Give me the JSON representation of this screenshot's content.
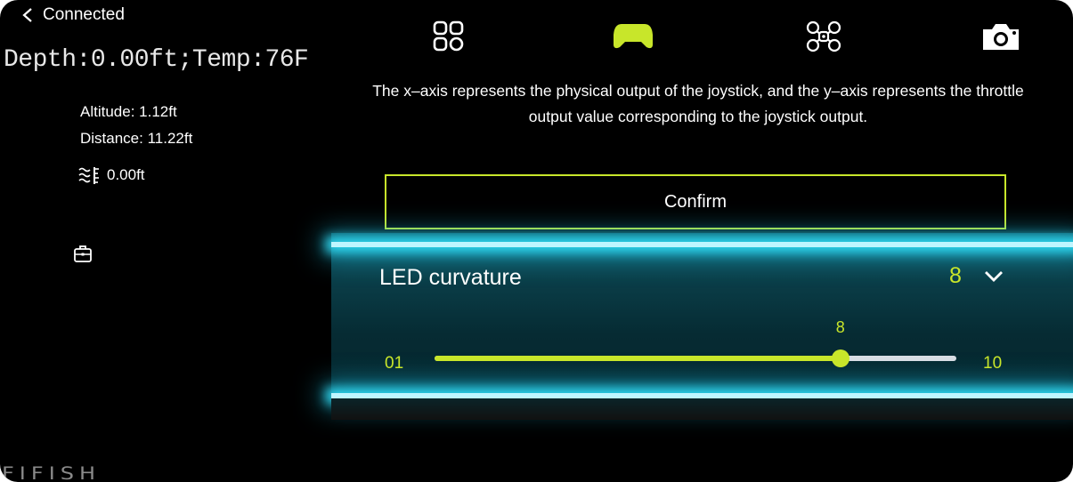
{
  "header": {
    "back_label": "Connected",
    "telemetry": "Depth:0.00ft;Temp:76F"
  },
  "stats": {
    "altitude": "Altitude: 1.12ft",
    "distance": "Distance: 11.22ft",
    "depth_value": "0.00ft"
  },
  "nav": {
    "icons": [
      "grid-icon",
      "gamepad-icon",
      "drone-icon",
      "camera-icon"
    ],
    "active": "gamepad-icon"
  },
  "description": "The x–axis represents the physical output of the joystick, and the y–axis represents the throttle output value corresponding to the joystick output.",
  "confirm_label": "Confirm",
  "led": {
    "label": "LED curvature",
    "value": "8",
    "slider_min_label": "01",
    "slider_max_label": "10",
    "slider_current_label": "8",
    "slider_min": 1,
    "slider_max": 10,
    "slider_value": 8
  },
  "brand": "FIFISH",
  "colors": {
    "accent": "#c8e62a",
    "panel_glow": "#2fd7f0",
    "background": "#000000"
  }
}
